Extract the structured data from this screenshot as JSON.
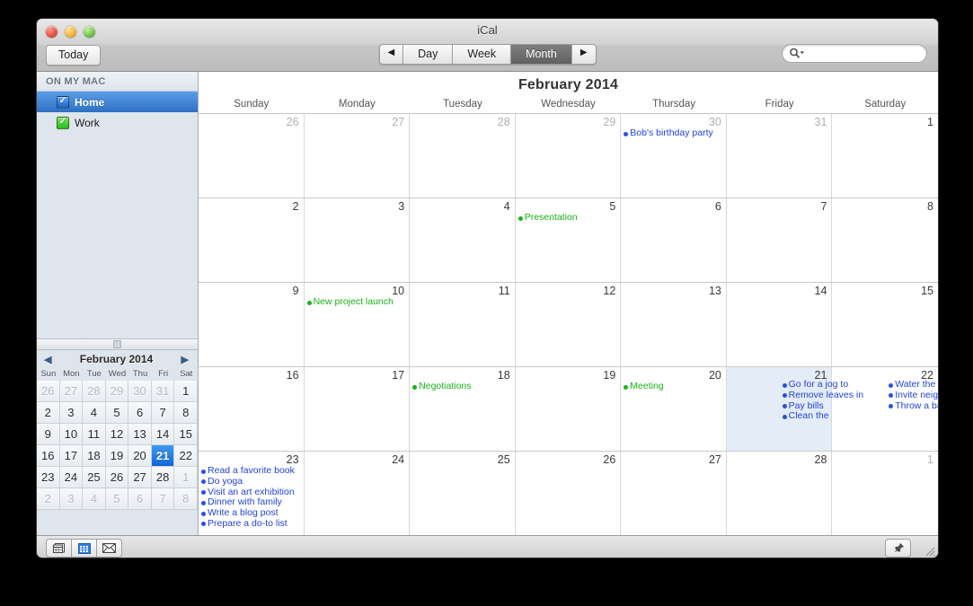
{
  "window": {
    "title": "iCal"
  },
  "toolbar": {
    "today_label": "Today",
    "prev_label": "◀",
    "next_label": "▶",
    "views": [
      "Day",
      "Week",
      "Month"
    ],
    "active_view": "Month",
    "search_value": "",
    "search_placeholder": ""
  },
  "sidebar": {
    "group_label": "ON MY MAC",
    "calendars": [
      {
        "name": "Home",
        "color": "#1a64c8",
        "checked": true,
        "selected": true
      },
      {
        "name": "Work",
        "color": "#23bf1f",
        "checked": true,
        "selected": false
      }
    ],
    "mini_calendar": {
      "title": "February 2014",
      "prev_label": "◀",
      "next_label": "▶",
      "weekdays": [
        "Sun",
        "Mon",
        "Tue",
        "Wed",
        "Thu",
        "Fri",
        "Sat"
      ],
      "selected_day": 21,
      "weeks": [
        [
          {
            "d": 26,
            "o": true
          },
          {
            "d": 27,
            "o": true
          },
          {
            "d": 28,
            "o": true
          },
          {
            "d": 29,
            "o": true
          },
          {
            "d": 30,
            "o": true
          },
          {
            "d": 31,
            "o": true
          },
          {
            "d": 1,
            "o": false
          }
        ],
        [
          {
            "d": 2,
            "o": false
          },
          {
            "d": 3,
            "o": false
          },
          {
            "d": 4,
            "o": false
          },
          {
            "d": 5,
            "o": false
          },
          {
            "d": 6,
            "o": false
          },
          {
            "d": 7,
            "o": false
          },
          {
            "d": 8,
            "o": false
          }
        ],
        [
          {
            "d": 9,
            "o": false
          },
          {
            "d": 10,
            "o": false
          },
          {
            "d": 11,
            "o": false
          },
          {
            "d": 12,
            "o": false
          },
          {
            "d": 13,
            "o": false
          },
          {
            "d": 14,
            "o": false
          },
          {
            "d": 15,
            "o": false
          }
        ],
        [
          {
            "d": 16,
            "o": false
          },
          {
            "d": 17,
            "o": false
          },
          {
            "d": 18,
            "o": false
          },
          {
            "d": 19,
            "o": false
          },
          {
            "d": 20,
            "o": false
          },
          {
            "d": 21,
            "o": false,
            "sel": true
          },
          {
            "d": 22,
            "o": false
          }
        ],
        [
          {
            "d": 23,
            "o": false
          },
          {
            "d": 24,
            "o": false
          },
          {
            "d": 25,
            "o": false
          },
          {
            "d": 26,
            "o": false
          },
          {
            "d": 27,
            "o": false
          },
          {
            "d": 28,
            "o": false
          },
          {
            "d": 1,
            "o": true
          }
        ],
        [
          {
            "d": 2,
            "o": true
          },
          {
            "d": 3,
            "o": true
          },
          {
            "d": 4,
            "o": true
          },
          {
            "d": 5,
            "o": true
          },
          {
            "d": 6,
            "o": true
          },
          {
            "d": 7,
            "o": true
          },
          {
            "d": 8,
            "o": true
          }
        ]
      ]
    }
  },
  "calendar": {
    "month_title": "February 2014",
    "weekday_headers": [
      "Sunday",
      "Monday",
      "Tuesday",
      "Wednesday",
      "Thursday",
      "Friday",
      "Saturday"
    ],
    "selected_date": 21,
    "weeks": [
      [
        {
          "day": 26,
          "other": true,
          "events": []
        },
        {
          "day": 27,
          "other": true,
          "events": []
        },
        {
          "day": 28,
          "other": true,
          "events": []
        },
        {
          "day": 29,
          "other": true,
          "events": []
        },
        {
          "day": 30,
          "other": true,
          "events": [
            {
              "title": "Bob's birthday party",
              "cal": "blue"
            }
          ]
        },
        {
          "day": 31,
          "other": true,
          "events": []
        },
        {
          "day": 1,
          "other": false,
          "events": []
        }
      ],
      [
        {
          "day": 2,
          "other": false,
          "events": []
        },
        {
          "day": 3,
          "other": false,
          "events": []
        },
        {
          "day": 4,
          "other": false,
          "events": []
        },
        {
          "day": 5,
          "other": false,
          "events": [
            {
              "title": "Presentation",
              "cal": "green"
            }
          ]
        },
        {
          "day": 6,
          "other": false,
          "events": []
        },
        {
          "day": 7,
          "other": false,
          "events": []
        },
        {
          "day": 8,
          "other": false,
          "events": []
        }
      ],
      [
        {
          "day": 9,
          "other": false,
          "events": []
        },
        {
          "day": 10,
          "other": false,
          "events": [
            {
              "title": "New project launch",
              "cal": "green"
            }
          ]
        },
        {
          "day": 11,
          "other": false,
          "events": []
        },
        {
          "day": 12,
          "other": false,
          "events": []
        },
        {
          "day": 13,
          "other": false,
          "events": []
        },
        {
          "day": 14,
          "other": false,
          "events": []
        },
        {
          "day": 15,
          "other": false,
          "events": []
        }
      ],
      [
        {
          "day": 16,
          "other": false,
          "events": []
        },
        {
          "day": 17,
          "other": false,
          "events": []
        },
        {
          "day": 18,
          "other": false,
          "events": [
            {
              "title": "Negotiations",
              "cal": "green"
            }
          ]
        },
        {
          "day": 19,
          "other": false,
          "events": []
        },
        {
          "day": 20,
          "other": false,
          "events": [
            {
              "title": "Meeting",
              "cal": "green"
            }
          ]
        },
        {
          "day": 21,
          "other": false,
          "selected": true,
          "events": []
        },
        {
          "day": 22,
          "other": false,
          "events": [],
          "columns": [
            [
              {
                "title": "Go for a jog to",
                "cal": "blue"
              },
              {
                "title": "Remove leaves in",
                "cal": "blue"
              },
              {
                "title": "Pay bills",
                "cal": "blue"
              },
              {
                "title": "Clean the",
                "cal": "blue"
              }
            ],
            [
              {
                "title": "Water the flowers",
                "cal": "blue"
              },
              {
                "title": "Invite neigh-",
                "cal": "blue"
              },
              {
                "title": "Throw a barbecue",
                "cal": "blue"
              }
            ]
          ]
        }
      ],
      [
        {
          "day": 23,
          "other": false,
          "events": [
            {
              "title": "Read a favorite book",
              "cal": "blue"
            },
            {
              "title": "Do yoga",
              "cal": "blue"
            },
            {
              "title": "Visit an art exhibition",
              "cal": "blue"
            },
            {
              "title": "Dinner with family",
              "cal": "blue"
            },
            {
              "title": "Write a blog post",
              "cal": "blue"
            },
            {
              "title": "Prepare a do-to list",
              "cal": "blue"
            }
          ]
        },
        {
          "day": 24,
          "other": false,
          "events": []
        },
        {
          "day": 25,
          "other": false,
          "events": []
        },
        {
          "day": 26,
          "other": false,
          "events": []
        },
        {
          "day": 27,
          "other": false,
          "events": []
        },
        {
          "day": 28,
          "other": false,
          "events": []
        },
        {
          "day": 1,
          "other": true,
          "events": []
        }
      ]
    ]
  },
  "bottom_bar": {
    "buttons": [
      "calendar-list-icon",
      "calendar-grid-icon",
      "mail-icon"
    ],
    "active_button": "calendar-grid-icon",
    "pin_button": "pushpin-icon"
  }
}
